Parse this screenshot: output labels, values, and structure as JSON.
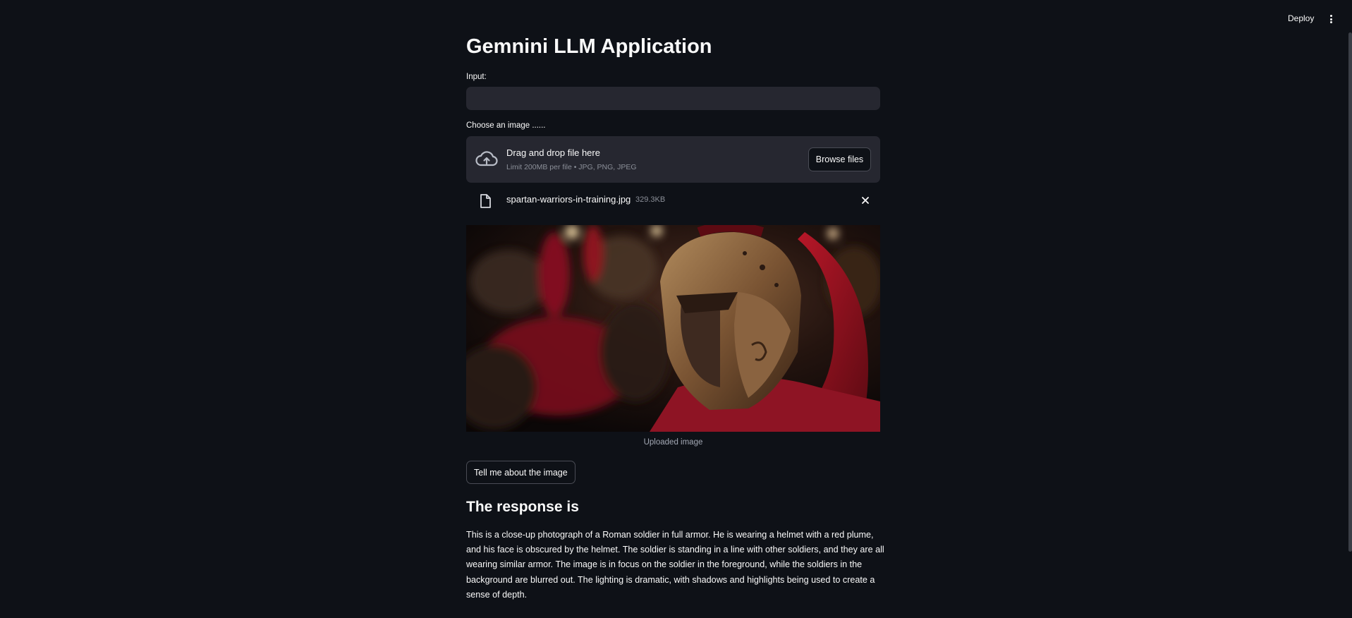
{
  "header": {
    "deploy_label": "Deploy",
    "menu_icon": "kebab-menu-icon"
  },
  "main": {
    "title": "Gemnini LLM Application",
    "input": {
      "label": "Input:",
      "value": "",
      "placeholder": ""
    },
    "uploader": {
      "label": "Choose an image ......",
      "drop_title": "Drag and drop file here",
      "drop_limit": "Limit 200MB per file • JPG, PNG, JPEG",
      "browse_label": "Browse files",
      "icon": "cloud-upload-icon"
    },
    "uploaded_file": {
      "name": "spartan-warriors-in-training.jpg",
      "size": "329.3KB",
      "icon": "file-icon",
      "remove_icon": "close-icon"
    },
    "image": {
      "caption": "Uploaded image"
    },
    "submit_label": "Tell me about the image",
    "response": {
      "heading": "The response is",
      "text": "This is a close-up photograph of a Roman soldier in full armor. He is wearing a helmet with a red plume, and his face is obscured by the helmet. The soldier is standing in a line with other soldiers, and they are all wearing similar armor. The image is in focus on the soldier in the foreground, while the soldiers in the background are blurred out. The lighting is dramatic, with shadows and highlights being used to create a sense of depth."
    }
  },
  "colors": {
    "background": "#0e1117",
    "widget_bg": "#262730",
    "text": "#fafafa",
    "muted": "#8b8f98",
    "accent_red": "#b3121f"
  }
}
